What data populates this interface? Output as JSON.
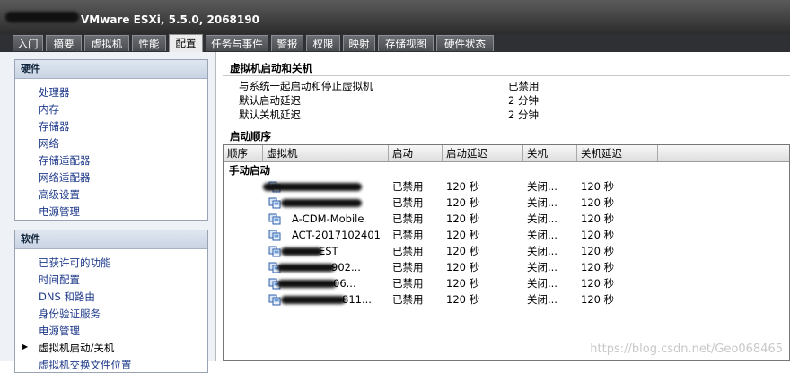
{
  "window": {
    "title": "VMware ESXi, 5.5.0, 2068190"
  },
  "tabs": [
    {
      "label": "入门"
    },
    {
      "label": "摘要"
    },
    {
      "label": "虚拟机"
    },
    {
      "label": "性能"
    },
    {
      "label": "配置",
      "active": true
    },
    {
      "label": "任务与事件"
    },
    {
      "label": "警报"
    },
    {
      "label": "权限"
    },
    {
      "label": "映射"
    },
    {
      "label": "存储视图"
    },
    {
      "label": "硬件状态"
    }
  ],
  "sidebar": {
    "hardware": {
      "title": "硬件",
      "items": [
        "处理器",
        "内存",
        "存储器",
        "网络",
        "存储适配器",
        "网络适配器",
        "高级设置",
        "电源管理"
      ]
    },
    "software": {
      "title": "软件",
      "items": [
        "已获许可的功能",
        "时间配置",
        "DNS 和路由",
        "身份验证服务",
        "电源管理",
        "虚拟机启动/关机",
        "虚拟机交换文件位置"
      ],
      "selected_index": 5
    }
  },
  "main": {
    "section_title": "虚拟机启动和关机",
    "settings": [
      {
        "label": "与系统一起启动和停止虚拟机",
        "value": "已禁用"
      },
      {
        "label": "默认启动延迟",
        "value": "2 分钟"
      },
      {
        "label": "默认关机延迟",
        "value": "2 分钟"
      }
    ],
    "order_title": "启动顺序",
    "columns": [
      "顺序",
      "虚拟机",
      "启动",
      "启动延迟",
      "关机",
      "关机延迟"
    ],
    "group_label": "手动启动",
    "rows": [
      {
        "vm": "",
        "start": "已禁用",
        "start_delay": "120 秒",
        "shutdown": "关闭...",
        "shutdown_delay": "120 秒"
      },
      {
        "vm": "",
        "start": "已禁用",
        "start_delay": "120 秒",
        "shutdown": "关闭...",
        "shutdown_delay": "120 秒"
      },
      {
        "vm": "A-CDM-Mobile",
        "start": "已禁用",
        "start_delay": "120 秒",
        "shutdown": "关闭...",
        "shutdown_delay": "120 秒"
      },
      {
        "vm": "ACT-2017102401",
        "start": "已禁用",
        "start_delay": "120 秒",
        "shutdown": "关闭...",
        "shutdown_delay": "120 秒"
      },
      {
        "vm": "EST",
        "start": "已禁用",
        "start_delay": "120 秒",
        "shutdown": "关闭...",
        "shutdown_delay": "120 秒"
      },
      {
        "vm": "902...",
        "start": "已禁用",
        "start_delay": "120 秒",
        "shutdown": "关闭...",
        "shutdown_delay": "120 秒"
      },
      {
        "vm": "06...",
        "start": "已禁用",
        "start_delay": "120 秒",
        "shutdown": "关闭...",
        "shutdown_delay": "120 秒"
      },
      {
        "vm": "811...",
        "start": "已禁用",
        "start_delay": "120 秒",
        "shutdown": "关闭...",
        "shutdown_delay": "120 秒"
      }
    ]
  },
  "watermark": "https://blog.csdn.net/Geo068465",
  "icons": {
    "vm": "virtual-machine-icon",
    "selected_marker": "triangle-right-icon"
  }
}
